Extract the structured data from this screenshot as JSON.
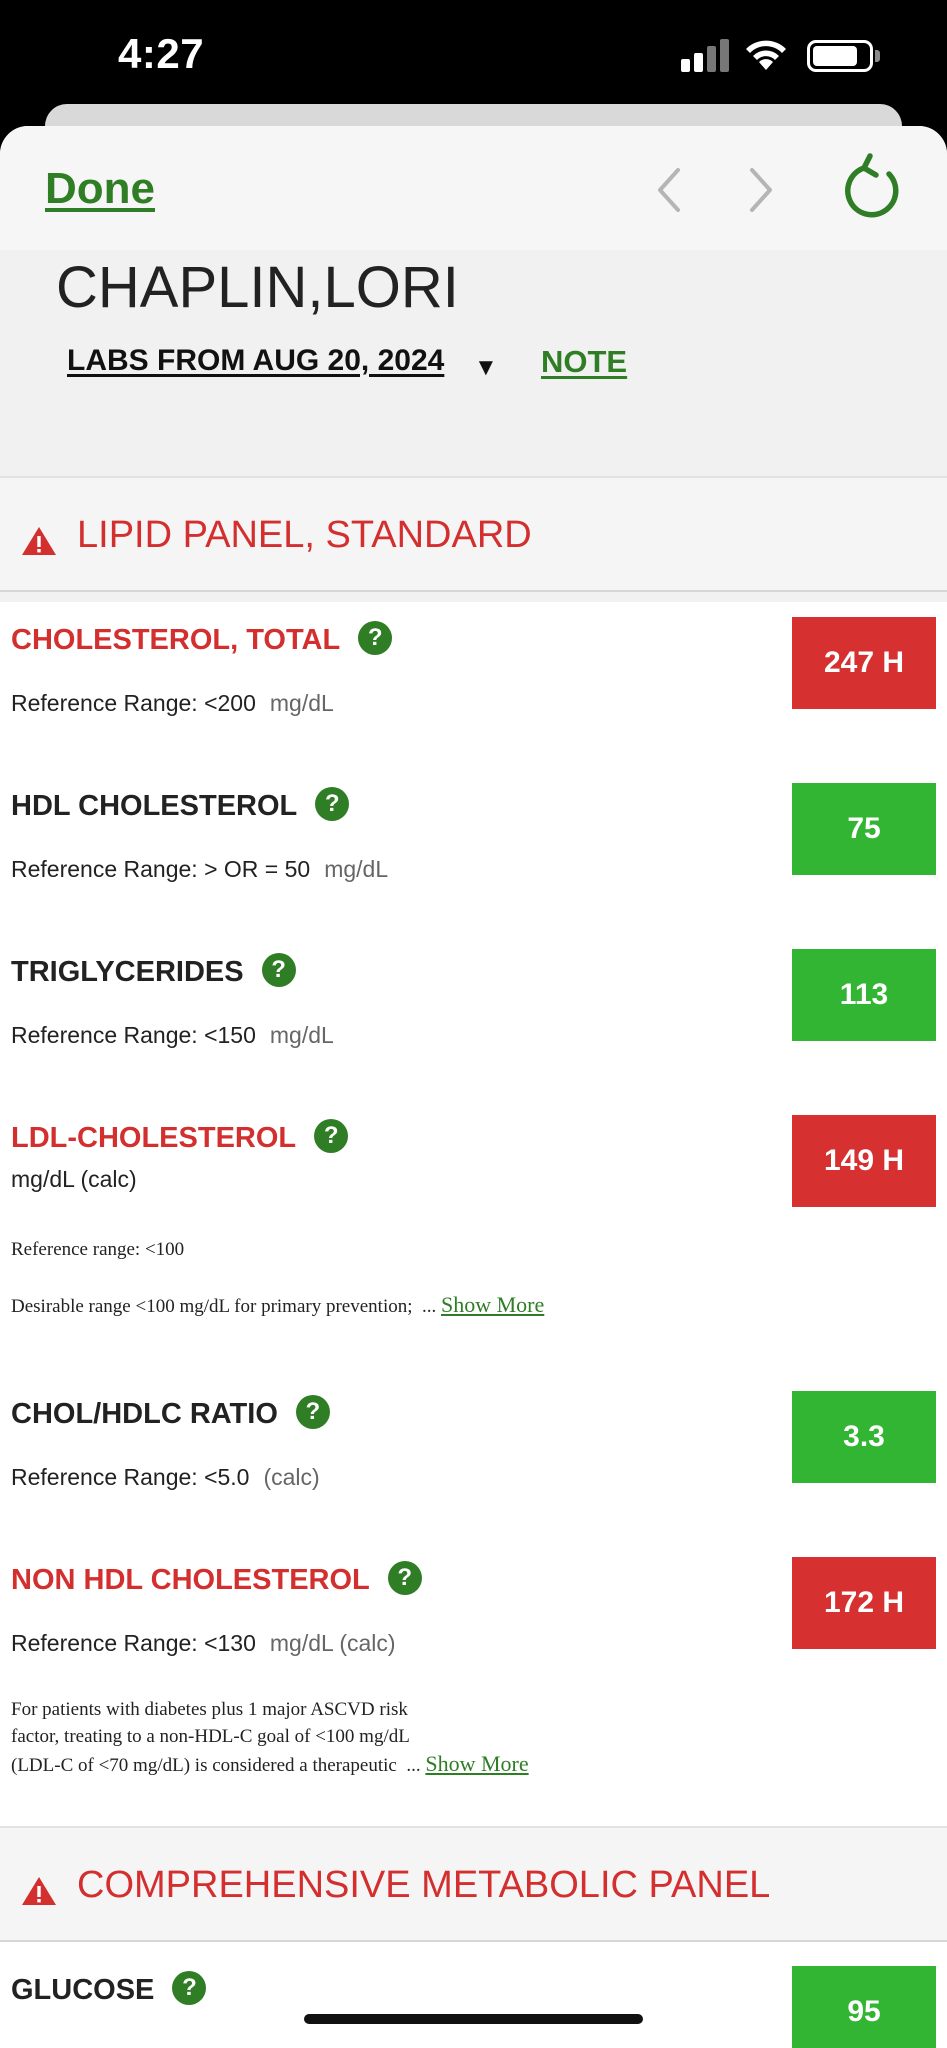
{
  "status_bar": {
    "time": "4:27"
  },
  "nav": {
    "done_label": "Done",
    "icons": {
      "back": "chevron-left-icon",
      "forward": "chevron-right-icon",
      "refresh": "refresh-icon"
    }
  },
  "patient": {
    "name": "CHAPLIN,LORI",
    "labs_date_label": "LABS FROM AUG 20, 2024",
    "note_label": "NOTE"
  },
  "colors": {
    "accent_green": "#2f7d25",
    "high_red": "#d63030",
    "normal_green": "#32b532",
    "section_red": "#d32f2f"
  },
  "sections": [
    {
      "title": "LIPID PANEL, STANDARD",
      "icon": "warning-icon",
      "labs": [
        {
          "name": "CHOLESTEROL, TOTAL",
          "flag": "high",
          "value": "247 H",
          "ref": "Reference Range: <200",
          "unit": "mg/dL"
        },
        {
          "name": "HDL CHOLESTEROL",
          "flag": "normal",
          "value": "75",
          "ref": "Reference Range: > OR = 50",
          "unit": "mg/dL"
        },
        {
          "name": "TRIGLYCERIDES",
          "flag": "normal",
          "value": "113",
          "ref": "Reference Range: <150",
          "unit": "mg/dL"
        },
        {
          "name": "LDL-CHOLESTEROL",
          "flag": "high",
          "value": "149 H",
          "sub": "mg/dL (calc)",
          "comment_1": "Reference range: <100",
          "comment_2": "Desirable range <100 mg/dL for primary prevention;",
          "ellipsis": "...",
          "show_more": "Show More"
        },
        {
          "name": "CHOL/HDLC RATIO",
          "flag": "normal",
          "value": "3.3",
          "ref": "Reference Range: <5.0",
          "unit": "(calc)"
        },
        {
          "name": "NON HDL CHOLESTEROL",
          "flag": "high",
          "value": "172 H",
          "ref": "Reference Range: <130",
          "unit": "mg/dL (calc)",
          "comment_line_1": "For patients with diabetes plus 1 major ASCVD risk",
          "comment_line_2": "factor, treating to a non-HDL-C goal of <100 mg/dL",
          "comment_line_3": "(LDL-C of <70 mg/dL) is considered a therapeutic",
          "ellipsis": "...",
          "show_more": "Show More"
        }
      ]
    },
    {
      "title": "COMPREHENSIVE METABOLIC PANEL",
      "icon": "warning-icon",
      "labs": [
        {
          "name": "GLUCOSE",
          "flag": "normal",
          "value": "95"
        }
      ]
    }
  ]
}
